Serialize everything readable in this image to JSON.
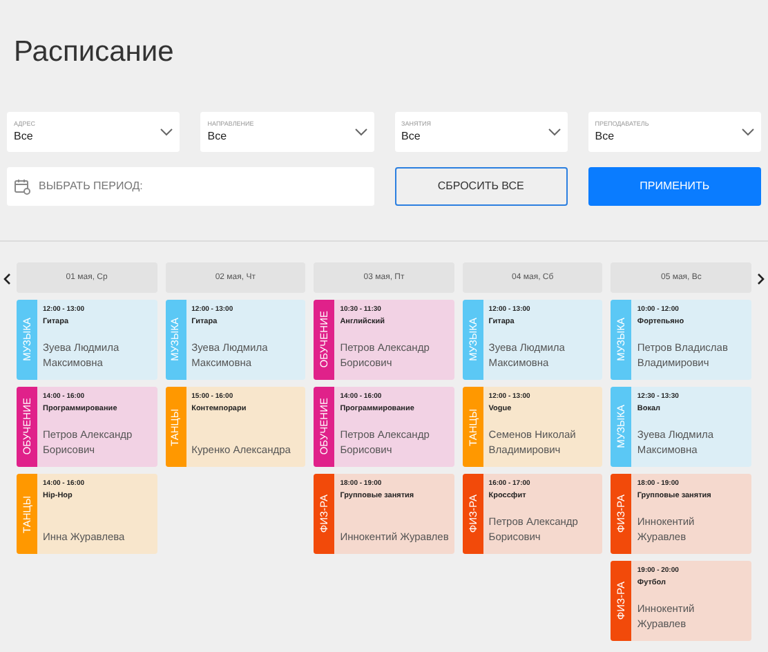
{
  "title": "Расписание",
  "filters": [
    {
      "label": "АДРЕС",
      "value": "Все"
    },
    {
      "label": "НАПРАВЛЕНИЕ",
      "value": "Все"
    },
    {
      "label": "ЗАНЯТИЯ",
      "value": "Все"
    },
    {
      "label": "ПРЕПОДАВАТЕЛЬ",
      "value": "Все"
    }
  ],
  "period": {
    "placeholder": "ВЫБРАТЬ ПЕРИОД:"
  },
  "reset_button": "СБРОСИТЬ ВСЕ",
  "apply_button": "ПРИМЕНИТЬ",
  "days": [
    {
      "header": "01 мая, Ср",
      "lessons": [
        {
          "category": "МУЗЫКА",
          "color": "#5bc8f5",
          "time": "12:00 - 13:00",
          "name": "Гитара",
          "teacher": "Зуева Людмила Максимовна"
        },
        {
          "category": "ОБУЧЕНИЕ",
          "color": "#e0218a",
          "time": "14:00 - 16:00",
          "name": "Программирование",
          "teacher": "Петров Александр Борисович"
        },
        {
          "category": "ТАНЦЫ",
          "color": "#ff9800",
          "time": "14:00 - 16:00",
          "name": "Hip-Hop",
          "teacher": "Инна Журавлева"
        }
      ]
    },
    {
      "header": "02 мая, Чт",
      "lessons": [
        {
          "category": "МУЗЫКА",
          "color": "#5bc8f5",
          "time": "12:00 - 13:00",
          "name": "Гитара",
          "teacher": "Зуева Людмила Максимовна"
        },
        {
          "category": "ТАНЦЫ",
          "color": "#ff9800",
          "time": "15:00 - 16:00",
          "name": "Контемпорари",
          "teacher": "Куренко Александра"
        }
      ]
    },
    {
      "header": "03 мая, Пт",
      "lessons": [
        {
          "category": "ОБУЧЕНИЕ",
          "color": "#e0218a",
          "time": "10:30 - 11:30",
          "name": "Английский",
          "teacher": "Петров Александр Борисович"
        },
        {
          "category": "ОБУЧЕНИЕ",
          "color": "#e0218a",
          "time": "14:00 - 16:00",
          "name": "Программирование",
          "teacher": "Петров Александр Борисович"
        },
        {
          "category": "ФИЗ-РА",
          "color": "#f24a0a",
          "time": "18:00 - 19:00",
          "name": "Групповые занятия",
          "teacher": "Иннокентий Журавлев"
        }
      ]
    },
    {
      "header": "04 мая, Сб",
      "lessons": [
        {
          "category": "МУЗЫКА",
          "color": "#5bc8f5",
          "time": "12:00 - 13:00",
          "name": "Гитара",
          "teacher": "Зуева Людмила Максимовна"
        },
        {
          "category": "ТАНЦЫ",
          "color": "#ff9800",
          "time": "12:00 - 13:00",
          "name": "Vogue",
          "teacher": "Семенов Николай Владимирович"
        },
        {
          "category": "ФИЗ-РА",
          "color": "#f24a0a",
          "time": "16:00 - 17:00",
          "name": "Кроссфит",
          "teacher": "Петров Александр Борисович"
        }
      ]
    },
    {
      "header": "05 мая, Вс",
      "lessons": [
        {
          "category": "МУЗЫКА",
          "color": "#5bc8f5",
          "time": "10:00 - 12:00",
          "name": "Фортепьяно",
          "teacher": "Петров Владислав Владимирович"
        },
        {
          "category": "МУЗЫКА",
          "color": "#5bc8f5",
          "time": "12:30 - 13:30",
          "name": "Вокал",
          "teacher": "Зуева Людмила Максимовна"
        },
        {
          "category": "ФИЗ-РА",
          "color": "#f24a0a",
          "time": "18:00 - 19:00",
          "name": "Групповые занятия",
          "teacher": "Иннокентий Журавлев"
        },
        {
          "category": "ФИЗ-РА",
          "color": "#f24a0a",
          "time": "19:00 - 20:00",
          "name": "Футбол",
          "teacher": "Иннокентий Журавлев"
        }
      ]
    }
  ]
}
